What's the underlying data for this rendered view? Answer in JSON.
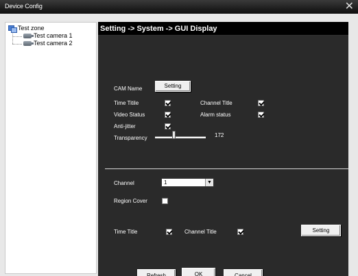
{
  "window": {
    "title": "Device Config",
    "close_glyph": "✕"
  },
  "tree": {
    "root": {
      "label": "Test zone",
      "icon": "zone-icon"
    },
    "children": [
      {
        "label": "Test camera 1",
        "icon": "camera-icon"
      },
      {
        "label": "Test camera 2",
        "icon": "camera-icon"
      }
    ]
  },
  "breadcrumb": "Setting -> System -> GUI Display",
  "cam_name": {
    "label": "CAM Name",
    "button": "Setting"
  },
  "options": {
    "time_title": {
      "label": "Time Titile",
      "checked": true
    },
    "channel_title": {
      "label": "Channel Title",
      "checked": true
    },
    "video_status": {
      "label": "Video Status",
      "checked": true
    },
    "alarm_status": {
      "label": "Alarm status",
      "checked": true
    },
    "anti_jitter": {
      "label": "Anti-jitter",
      "checked": true
    }
  },
  "transparency": {
    "label": "Transparency",
    "value": "172"
  },
  "channel": {
    "label": "Channel",
    "selected": "1"
  },
  "region_cover": {
    "label": "Region Cover",
    "checked": false
  },
  "lower": {
    "time_title": {
      "label": "Time Title",
      "checked": true
    },
    "channel_title": {
      "label": "Channel Title",
      "checked": true
    },
    "setting_button": "Setting"
  },
  "footer": {
    "refresh": "Refresh",
    "ok": "OK",
    "cancel": "Cancel"
  }
}
